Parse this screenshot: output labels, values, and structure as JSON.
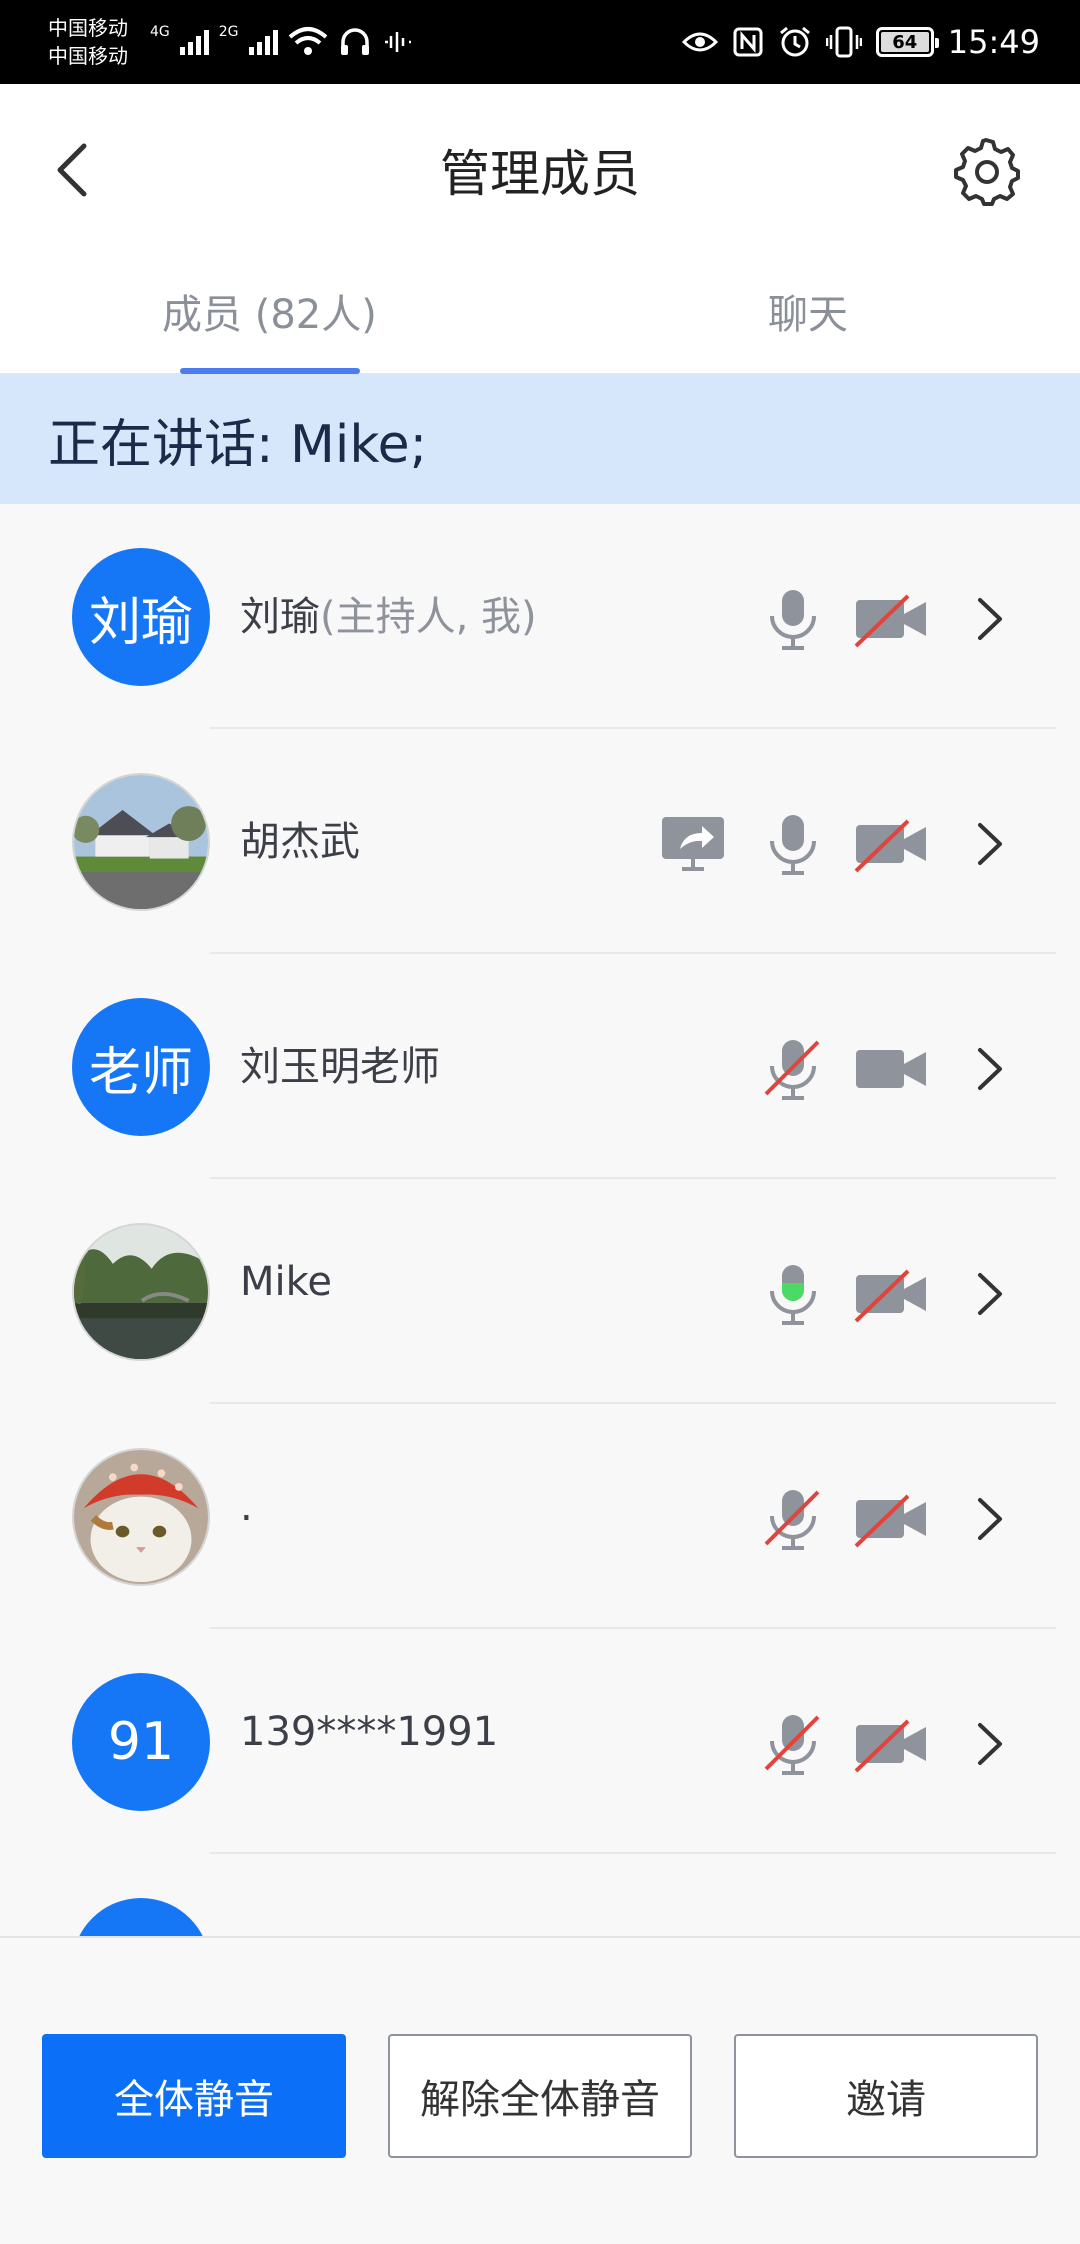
{
  "status_bar": {
    "carrier_line1": "中国移动",
    "carrier_line2": "中国移动",
    "net1": "4G",
    "net2": "2G",
    "battery": "64",
    "time": "15:49"
  },
  "header": {
    "title": "管理成员"
  },
  "tabs": [
    {
      "label": "成员 (82人)",
      "selected": true
    },
    {
      "label": "聊天",
      "selected": false
    }
  ],
  "speaking": "正在讲话: Mike;",
  "members": [
    {
      "avatar_text": "刘瑜",
      "name": "刘瑜",
      "role": "(主持人, 我)",
      "mic": "on",
      "camera": "off",
      "sharing": false
    },
    {
      "avatar_text": "",
      "name": "胡杰武",
      "role": "",
      "mic": "on",
      "camera": "off",
      "sharing": true
    },
    {
      "avatar_text": "老师",
      "name": "刘玉明老师",
      "role": "",
      "mic": "off",
      "camera": "on",
      "sharing": false
    },
    {
      "avatar_text": "",
      "name": "Mike",
      "role": "",
      "mic": "speaking",
      "camera": "off",
      "sharing": false
    },
    {
      "avatar_text": "",
      "name": ".",
      "role": "",
      "mic": "off",
      "camera": "off",
      "sharing": false
    },
    {
      "avatar_text": "91",
      "name": "139****1991",
      "role": "",
      "mic": "off",
      "camera": "off",
      "sharing": false
    }
  ],
  "footer": {
    "mute_all": "全体静音",
    "unmute_all": "解除全体静音",
    "invite": "邀请"
  },
  "colors": {
    "accent": "#1677f6",
    "banner": "#d7e7fb",
    "icon_gray": "#8f939b",
    "muted_red": "#e0443c",
    "speaking_green": "#4cd964"
  }
}
